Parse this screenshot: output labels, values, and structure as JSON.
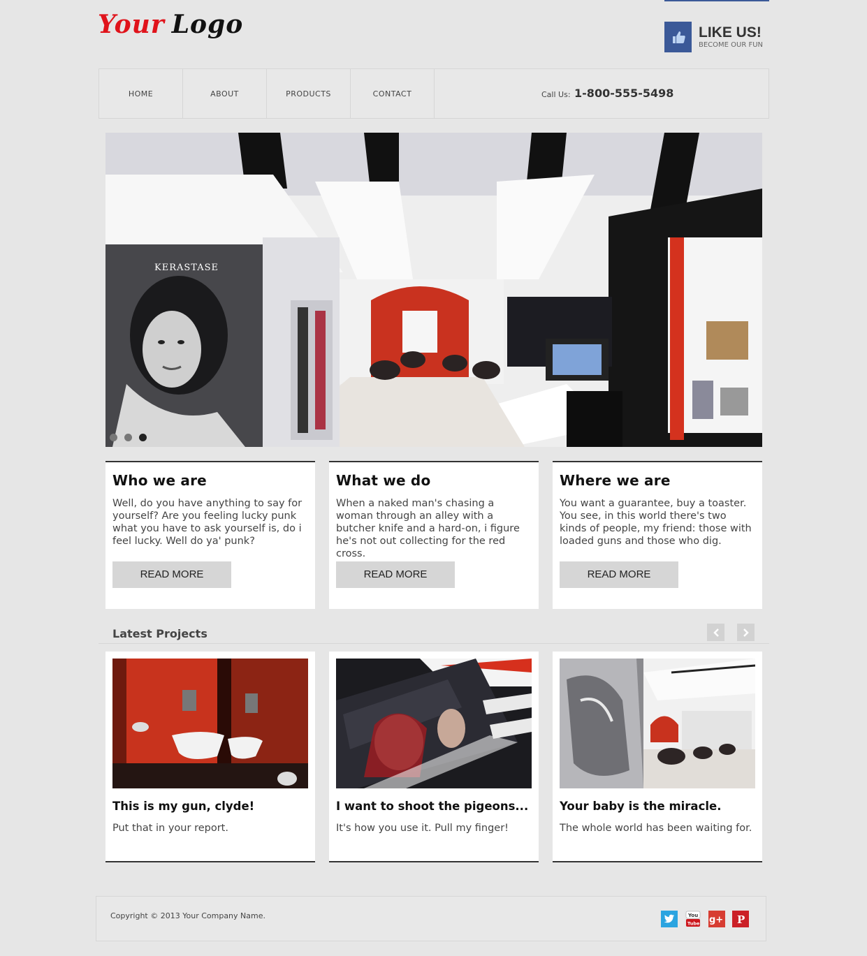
{
  "header": {
    "logo_word1": "Your",
    "logo_word2": "Logo",
    "like_title": "LIKE US!",
    "like_subtitle": "BECOME OUR FUN"
  },
  "nav": {
    "items": [
      "HOME",
      "ABOUT",
      "PRODUCTS",
      "CONTACT"
    ],
    "call_label": "Call Us:",
    "call_number": "1-800-555-5498"
  },
  "slider": {
    "slide_count": 3,
    "active_slide": 3,
    "poster_text": "KERASTASE"
  },
  "features": [
    {
      "title": "Who we are",
      "text": "Well, do you have anything to say for yourself? Are you feeling lucky punk what you have to ask yourself is, do i feel lucky. Well do ya' punk?",
      "button": "READ MORE"
    },
    {
      "title": "What we do",
      "text": "When a naked man's chasing a woman through an alley with a butcher knife and a hard-on, i figure he's not out collecting for the red cross.",
      "button": "READ MORE"
    },
    {
      "title": "Where we are",
      "text": "You want a guarantee, buy a toaster. You see, in this world there's two kinds of people, my friend: those with loaded guns and those who dig.",
      "button": "READ MORE"
    }
  ],
  "latest": {
    "title": "Latest Projects",
    "projects": [
      {
        "title": "This is my gun, clyde!",
        "text": "Put that in your report."
      },
      {
        "title": "I want to shoot the pigeons...",
        "text": "It's how you use it. Pull my finger!"
      },
      {
        "title": "Your baby is the miracle.",
        "text": "The whole world has been waiting for."
      }
    ]
  },
  "footer": {
    "copyright": "Copyright © 2013 Your Company Name.",
    "social": [
      "twitter-icon",
      "youtube-icon",
      "google-plus-icon",
      "pinterest-icon"
    ]
  },
  "colors": {
    "accent_red": "#e0131b",
    "facebook_blue": "#3b5998",
    "background": "#e6e6e6"
  }
}
